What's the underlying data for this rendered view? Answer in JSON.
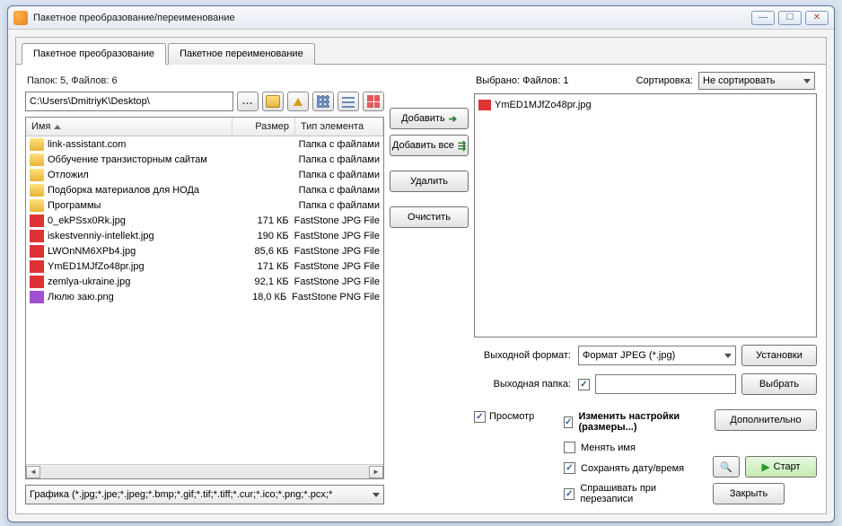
{
  "window": {
    "title": "Пакетное преобразование/переименование"
  },
  "tabs": [
    {
      "label": "Пакетное преобразование",
      "active": true
    },
    {
      "label": "Пакетное переименование",
      "active": false
    }
  ],
  "counts": "Папок: 5, Файлов: 6",
  "path": "C:\\Users\\DmitriyK\\Desktop\\",
  "columns": {
    "name": "Имя",
    "size": "Размер",
    "type": "Тип элемента"
  },
  "files": [
    {
      "icon": "folder",
      "name": "link-assistant.com",
      "size": "",
      "type": "Папка с файлами"
    },
    {
      "icon": "folder",
      "name": "Оббучение транзисторным сайтам",
      "size": "",
      "type": "Папка с файлами"
    },
    {
      "icon": "folder",
      "name": "Отложил",
      "size": "",
      "type": "Папка с файлами"
    },
    {
      "icon": "folder",
      "name": "Подборка материалов для НОДа",
      "size": "",
      "type": "Папка с файлами"
    },
    {
      "icon": "folder",
      "name": "Программы",
      "size": "",
      "type": "Папка с файлами"
    },
    {
      "icon": "jpg",
      "name": "0_ekPSsx0Rk.jpg",
      "size": "171 КБ",
      "type": "FastStone JPG File"
    },
    {
      "icon": "jpg",
      "name": "iskestvenniy-intellekt.jpg",
      "size": "190 КБ",
      "type": "FastStone JPG File"
    },
    {
      "icon": "jpg",
      "name": "LWOnNM6XPb4.jpg",
      "size": "85,6 КБ",
      "type": "FastStone JPG File"
    },
    {
      "icon": "jpg",
      "name": "YmED1MJfZo48pr.jpg",
      "size": "171 КБ",
      "type": "FastStone JPG File"
    },
    {
      "icon": "jpg",
      "name": "zemlya-ukraine.jpg",
      "size": "92,1 КБ",
      "type": "FastStone JPG File"
    },
    {
      "icon": "png",
      "name": "Люлю заю.png",
      "size": "18,0 КБ",
      "type": "FastStone PNG File"
    }
  ],
  "filter": "Графика (*.jpg;*.jpe;*.jpeg;*.bmp;*.gif;*.tif;*.tiff;*.cur;*.ico;*.png;*.pcx;*",
  "mid_buttons": {
    "add": "Добавить",
    "add_all": "Добавить все",
    "remove": "Удалить",
    "clear": "Очистить"
  },
  "right": {
    "selected_label": "Выбрано:  Файлов: 1",
    "sort_label": "Сортировка:",
    "sort_value": "Не сортировать",
    "selected_items": [
      {
        "icon": "jpg",
        "name": "YmED1MJfZo48pr.jpg"
      }
    ]
  },
  "output": {
    "format_label": "Выходной формат:",
    "format_value": "Формат JPEG (*.jpg)",
    "settings_btn": "Установки",
    "folder_label": "Выходная папка:",
    "folder_checked": true,
    "folder_value": "",
    "browse_btn": "Выбрать"
  },
  "options": {
    "preview_label": "Просмотр",
    "preview_checked": true,
    "resize_label": "Изменить настройки (размеры...)",
    "resize_checked": true,
    "rename_label": "Менять имя",
    "rename_checked": false,
    "keep_date_label": "Сохранять дату/время",
    "keep_date_checked": true,
    "ask_overwrite_label": "Спрашивать при перезаписи",
    "ask_overwrite_checked": true,
    "advanced_btn": "Дополнительно",
    "start_btn": "Старт",
    "close_btn": "Закрыть"
  }
}
